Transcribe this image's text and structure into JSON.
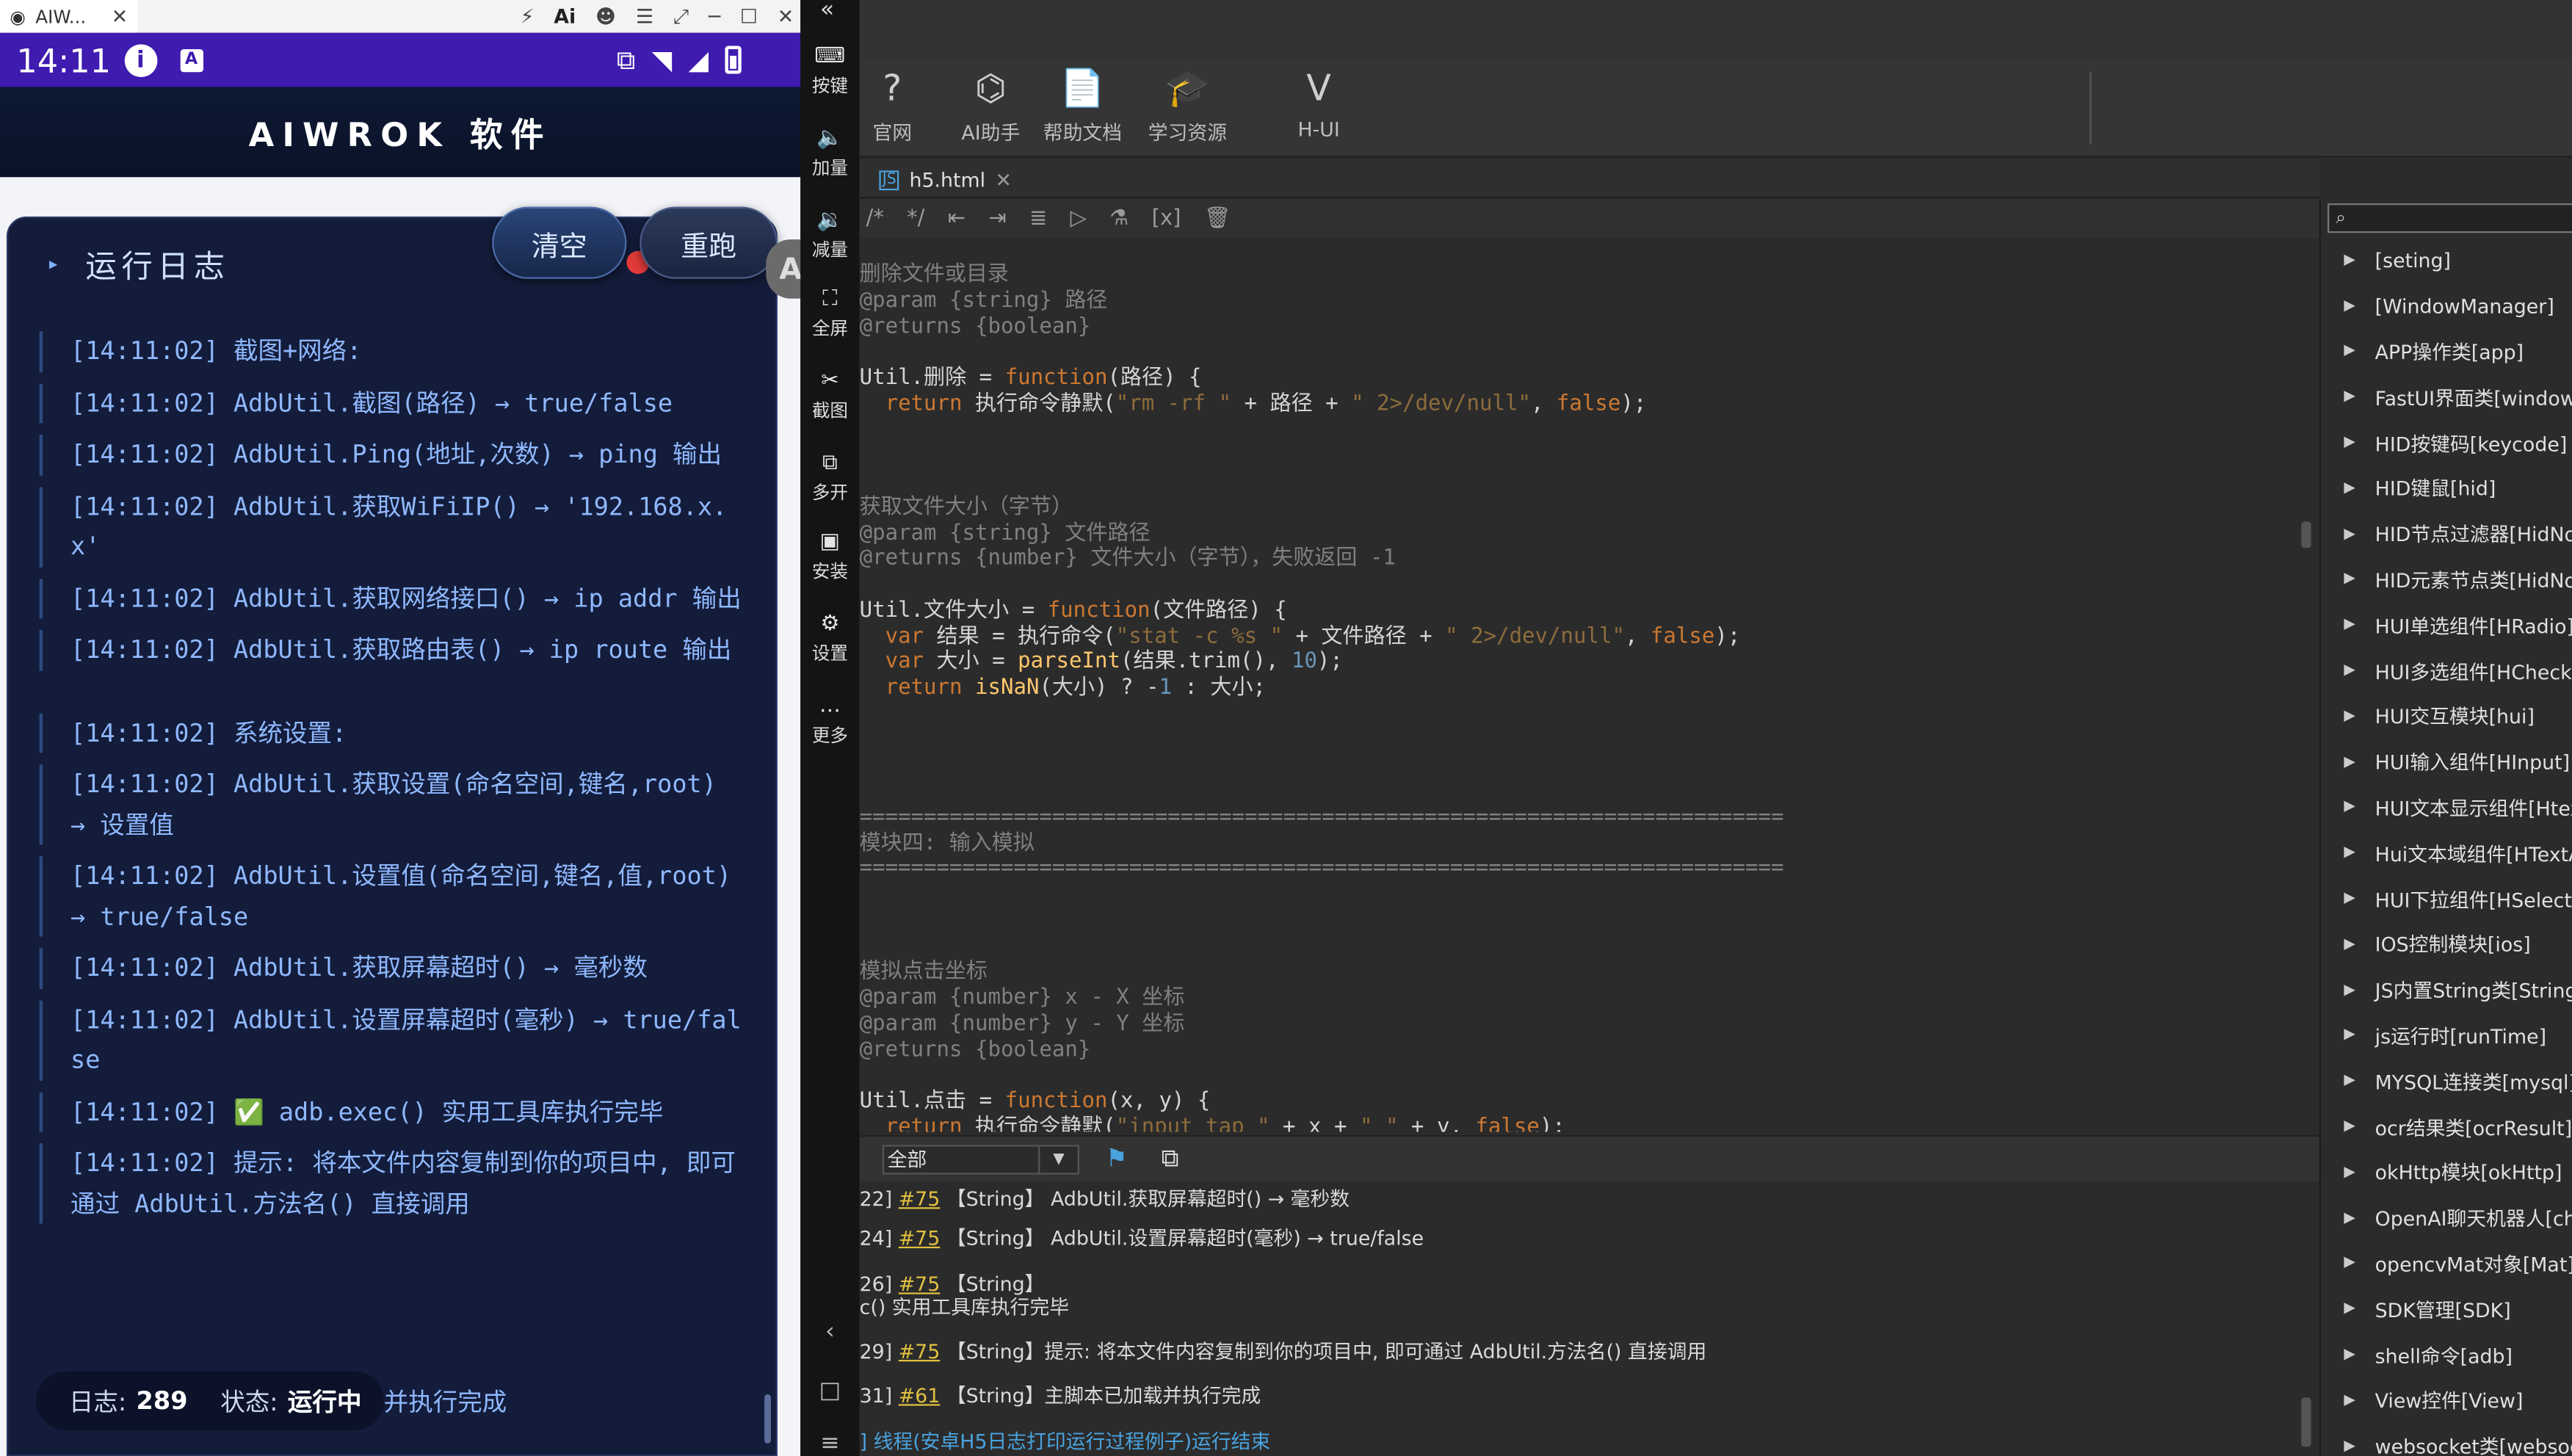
{
  "window": {
    "tab_title": "AIW...",
    "close": "✕",
    "icons": [
      "⚡",
      "Ai",
      "☻",
      "☰",
      "⤢",
      "─",
      "☐",
      "✕"
    ]
  },
  "phone": {
    "time": "14:11",
    "app_title": "AIWROK 软件",
    "log_title": "运行日志",
    "clear_button": "清空",
    "rerun_button": "重跑",
    "float_badge": "A",
    "log_lines": [
      "[14:11:02] 截图+网络:",
      "[14:11:02] AdbUtil.截图(路径) → true/false",
      "[14:11:02] AdbUtil.Ping(地址,次数) → ping 输出",
      "[14:11:02] AdbUtil.获取WiFiIP() → '192.168.x.x'",
      "[14:11:02] AdbUtil.获取网络接口() → ip addr 输出",
      "[14:11:02] AdbUtil.获取路由表() → ip route 输出",
      "[14:11:02] 系统设置:",
      "[14:11:02] AdbUtil.获取设置(命名空间,键名,root) → 设置值",
      "[14:11:02] AdbUtil.设置值(命名空间,键名,值,root) → true/false",
      "[14:11:02] AdbUtil.获取屏幕超时() → 毫秒数",
      "[14:11:02] AdbUtil.设置屏幕超时(毫秒) → true/false",
      "[14:11:02] ✅ adb.exec() 实用工具库执行完毕",
      "[14:11:02] 提示: 将本文件内容复制到你的项目中, 即可通过 AdbUtil.方法名() 直接调用"
    ],
    "status_log_label": "日志:",
    "status_log_count": "289",
    "status_state_label": "状态:",
    "status_state_value": "运行中",
    "status_tail": "并执行完成"
  },
  "side_tools": [
    {
      "icon": "⌨",
      "label": "按键"
    },
    {
      "icon": "🔈",
      "label": "加量"
    },
    {
      "icon": "🔉",
      "label": "减量"
    },
    {
      "icon": "⛶",
      "label": "全屏"
    },
    {
      "icon": "✂",
      "label": "截图"
    },
    {
      "icon": "⧉",
      "label": "多开"
    },
    {
      "icon": "▣",
      "label": "安装"
    },
    {
      "icon": "⚙",
      "label": "设置"
    },
    {
      "icon": "…",
      "label": "更多"
    }
  ],
  "side_nav": [
    "‹",
    "□",
    "≡"
  ],
  "toolbar": {
    "back": "«",
    "buttons": [
      {
        "icon": "?",
        "label": "官网"
      },
      {
        "icon": "⌬",
        "label": "AI助手"
      },
      {
        "icon": "📄",
        "label": "帮助文档"
      },
      {
        "icon": "🎓",
        "label": "学习资源"
      },
      {
        "icon": "V",
        "label": "H-UI"
      }
    ]
  },
  "file_tab": {
    "badge": "JS",
    "name": "h5.html",
    "close": "✕"
  },
  "edit_tools": [
    "/*",
    "*/",
    "⇤",
    "⇥",
    "≣",
    "▷",
    "⚗",
    "[x]",
    "🗑"
  ],
  "code_lines": [
    "删除文件或目录",
    "@param {string} 路径",
    "@returns {boolean}",
    "",
    "Util.删除 = function(路径) {",
    "  return 执行命令静默(\"rm -rf \" + 路径 + \" 2>/dev/null\", false);",
    "",
    "",
    "",
    "获取文件大小（字节）",
    "@param {string} 文件路径",
    "@returns {number} 文件大小（字节），失败返回 -1",
    "",
    "Util.文件大小 = function(文件路径) {",
    "  var 结果 = 执行命令(\"stat -c %s \" + 文件路径 + \" 2>/dev/null\", false);",
    "  var 大小 = parseInt(结果.trim(), 10);",
    "  return isNaN(大小) ? -1 : 大小;",
    "",
    "",
    "",
    "",
    "========================================================================",
    "模块四: 输入模拟",
    "========================================================================",
    "",
    "",
    "",
    "模拟点击坐标",
    "@param {number} x - X 坐标",
    "@param {number} y - Y 坐标",
    "@returns {boolean}",
    "",
    "Util.点击 = function(x, y) {",
    "  return 执行命令静默(\"input tap \" + x + \" \" + y, false);"
  ],
  "console": {
    "filter": "全部",
    "lines": [
      {
        "pre": "22] ",
        "link": "#75",
        "text": " 【String】 AdbUtil.获取屏幕超时() → 毫秒数"
      },
      {
        "pre": "24] ",
        "link": "#75",
        "text": " 【String】 AdbUtil.设置屏幕超时(毫秒) → true/false"
      },
      {
        "pre": "26] ",
        "link": "#75",
        "text": " 【String】"
      },
      {
        "pre": "",
        "link": "",
        "text": "c() 实用工具库执行完毕"
      },
      {
        "pre": "29] ",
        "link": "#75",
        "text": " 【String】提示: 将本文件内容复制到你的项目中, 即可通过 AdbUtil.方法名() 直接调用"
      },
      {
        "pre": "31] ",
        "link": "#61",
        "text": " 【String】主脚本已加载并执行完成"
      },
      {
        "pre": "",
        "link": "",
        "text": "] 线程(安卓H5日志打印运行过程例子)运行结束"
      }
    ]
  },
  "api_tree": [
    "[seting]",
    "[WindowManager]",
    "APP操作类[app]",
    "FastUI界面类[window]",
    "HID按键码[keycode]",
    "HID键鼠[hid]",
    "HID节点过滤器[HidNode]",
    "HID元素节点类[HidNode]",
    "HUI单选组件[HRadio]",
    "HUI多选组件[HCheck]",
    "HUI交互模块[hui]",
    "HUI输入组件[HInput]",
    "HUI文本显示组件[Htext]",
    "Hui文本域组件[HTextArea]",
    "HUI下拉组件[HSelect]",
    "IOS控制模块[ios]",
    "JS内置String类[String]",
    "js运行时[runTime]",
    "MYSQL连接类[mysql]",
    "ocr结果类[ocrResult]",
    "okHttp模块[okHttp]",
    "OpenAI聊天机器人[chat]",
    "opencvMat对象[Mat]",
    "SDK管理[SDK]",
    "shell命令[adb]",
    "View控件[View]",
    "websocket类[websocket]"
  ]
}
